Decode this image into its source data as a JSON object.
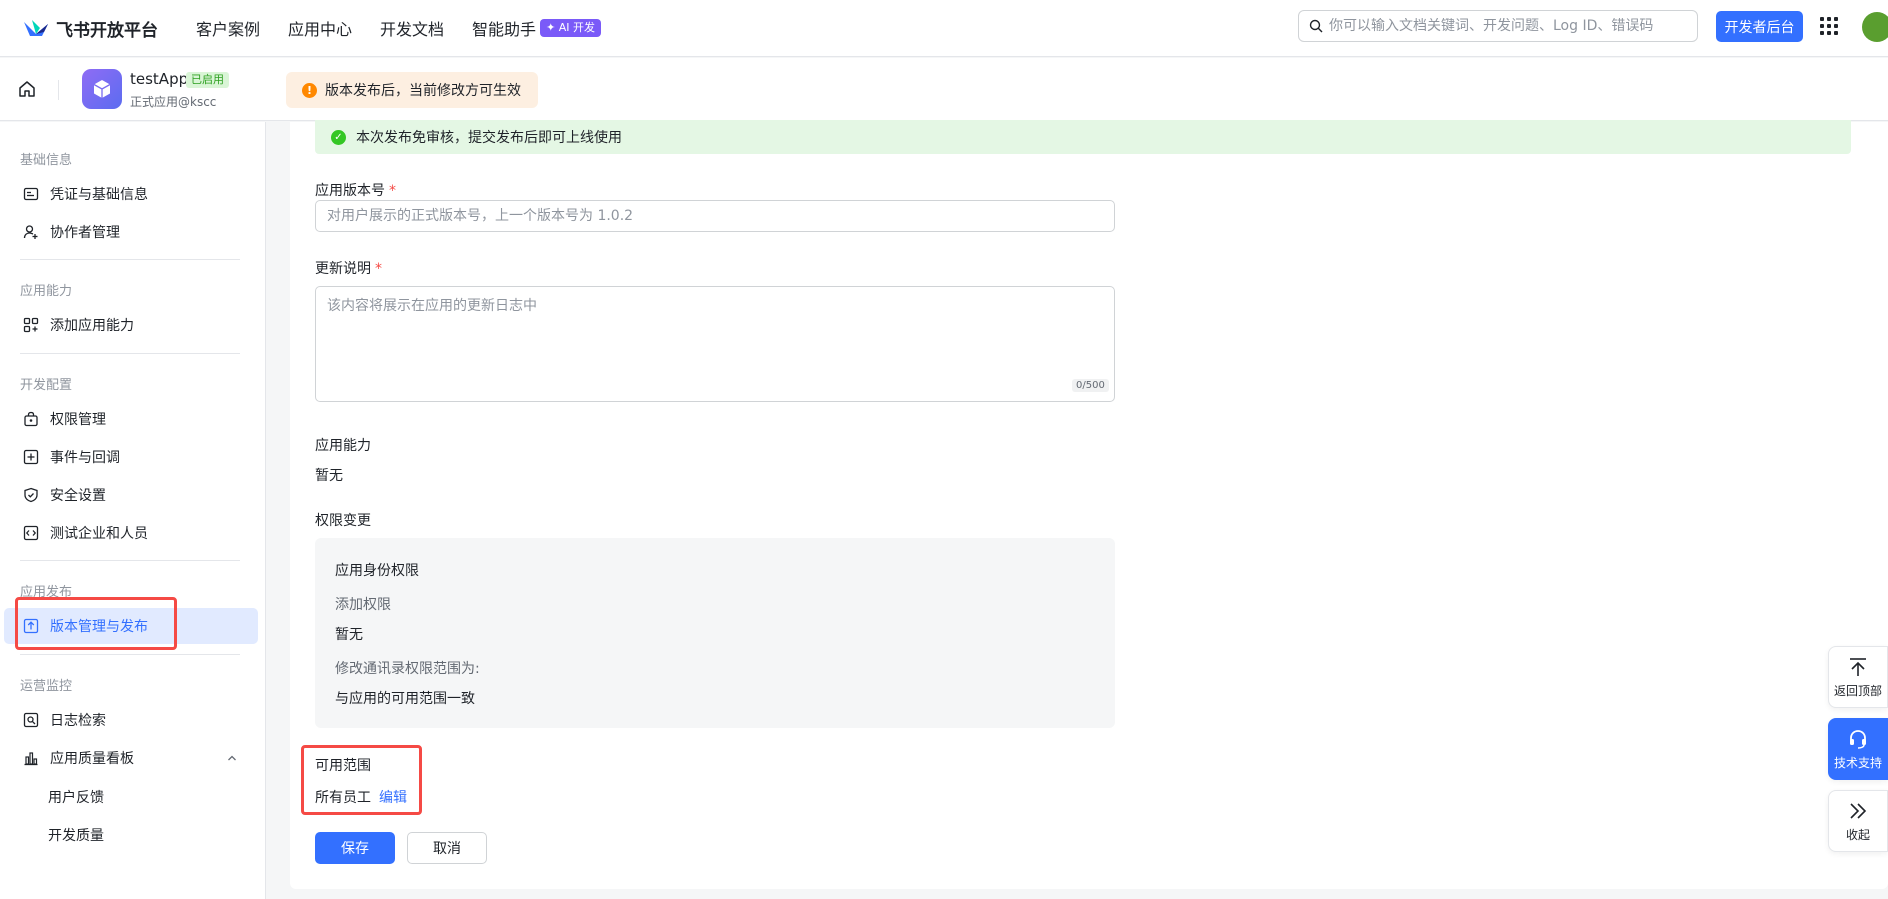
{
  "topbar": {
    "logo_text": "飞书开放平台",
    "nav": [
      "客户案例",
      "应用中心",
      "开发文档",
      "智能助手"
    ],
    "ai_badge": "✦ AI 开发",
    "search_placeholder": "你可以输入文档关键词、开发问题、Log ID、错误码",
    "dev_console": "开发者后台"
  },
  "app": {
    "name": "testApp",
    "status": "已启用",
    "subtitle": "正式应用@kscc",
    "notice": "版本发布后，当前修改方可生效"
  },
  "sidebar": {
    "groups": [
      "基础信息",
      "应用能力",
      "开发配置",
      "应用发布",
      "运营监控"
    ],
    "items": [
      {
        "label": "凭证与基础信息",
        "icon": "id-card-icon"
      },
      {
        "label": "协作者管理",
        "icon": "user-plus-icon"
      },
      {
        "label": "添加应用能力",
        "icon": "apps-grid-icon"
      },
      {
        "label": "权限管理",
        "icon": "lock-icon"
      },
      {
        "label": "事件与回调",
        "icon": "event-icon"
      },
      {
        "label": "安全设置",
        "icon": "shield-icon"
      },
      {
        "label": "测试企业和人员",
        "icon": "test-icon"
      },
      {
        "label": "版本管理与发布",
        "icon": "upload-icon"
      },
      {
        "label": "日志检索",
        "icon": "log-search-icon"
      },
      {
        "label": "应用质量看板",
        "icon": "bar-chart-icon"
      }
    ],
    "subitems": [
      "用户反馈",
      "开发质量"
    ]
  },
  "form": {
    "success_msg": "本次发布免审核，提交发布后即可上线使用",
    "version_label": "应用版本号",
    "version_placeholder": "对用户展示的正式版本号，上一个版本号为 1.0.2",
    "notes_label": "更新说明",
    "notes_placeholder": "该内容将展示在应用的更新日志中",
    "notes_counter": "0/500",
    "capability_label": "应用能力",
    "capability_value": "暂无",
    "perm_change_label": "权限变更",
    "perm_box": {
      "title": "应用身份权限",
      "add_label": "添加权限",
      "add_value": "暂无",
      "contact_label": "修改通讯录权限范围为:",
      "contact_value": "与应用的可用范围一致"
    },
    "scope_label": "可用范围",
    "scope_value": "所有员工",
    "scope_edit": "编辑",
    "required_mark": "*",
    "save": "保存",
    "cancel": "取消"
  },
  "float_tools": [
    "返回顶部",
    "技术支持",
    "收起"
  ]
}
